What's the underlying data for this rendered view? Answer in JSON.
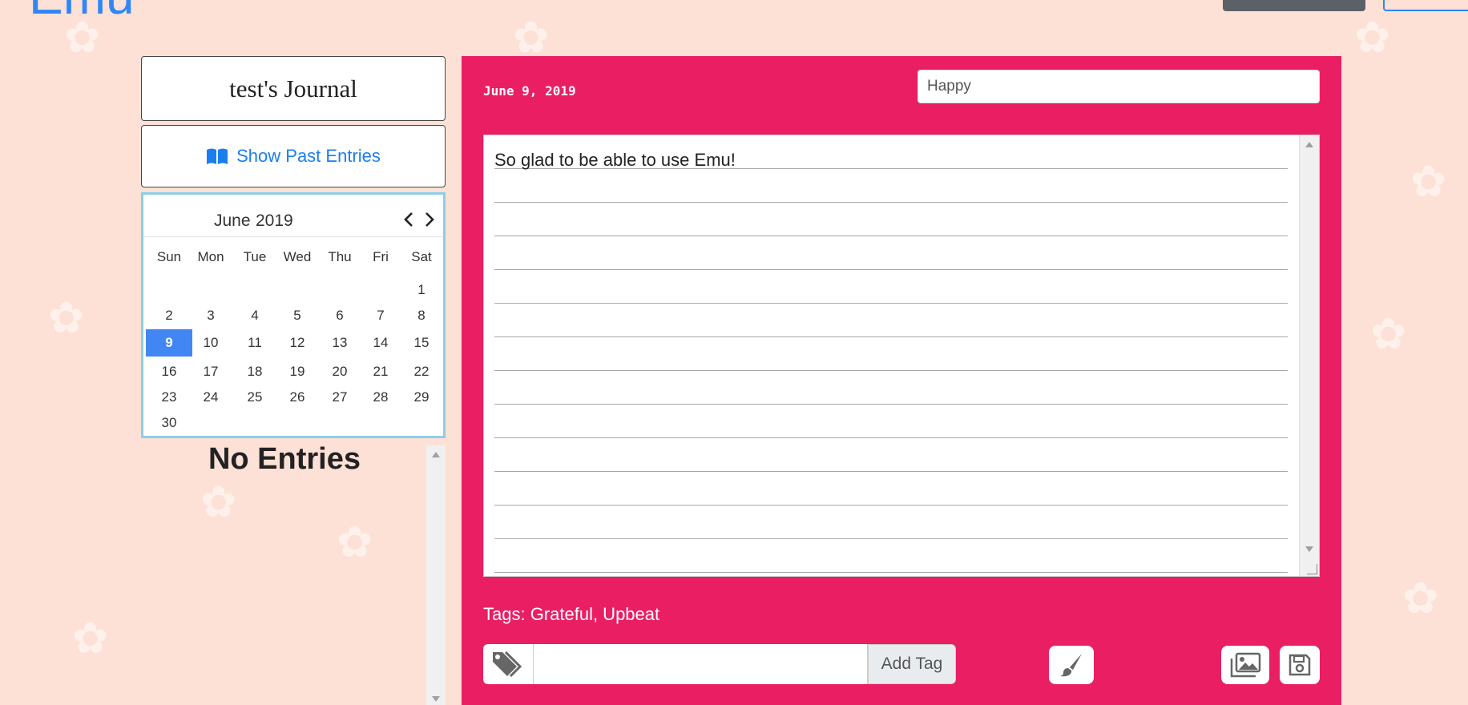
{
  "app": {
    "brand": "Emu"
  },
  "sidebar": {
    "journal_title": "test's Journal",
    "past_entries_label": "Show Past Entries",
    "no_entries": "No Entries"
  },
  "calendar": {
    "month": "June",
    "year": "2019",
    "weekdays": [
      "Sun",
      "Mon",
      "Tue",
      "Wed",
      "Thu",
      "Fri",
      "Sat"
    ],
    "first_weekday_index": 6,
    "days_in_month": 30,
    "selected_day": 9
  },
  "entry": {
    "date": "June 9, 2019",
    "mood": "Happy",
    "text": "So glad to be able to use Emu!",
    "tags_label": "Tags: Grateful, Upbeat",
    "tag_input_value": "",
    "add_tag_label": "Add Tag"
  },
  "icons": {
    "past_entries": "book-open-icon",
    "tag": "tags-icon",
    "style": "paintbrush-icon",
    "images": "images-icon",
    "save": "save-icon",
    "prev": "chevron-left-icon",
    "next": "chevron-right-icon"
  },
  "colors": {
    "page_background": "#fde0d6",
    "editor_background": "#ea1e63",
    "accent_blue": "#2f86f6",
    "selected_day": "#4286f4"
  }
}
